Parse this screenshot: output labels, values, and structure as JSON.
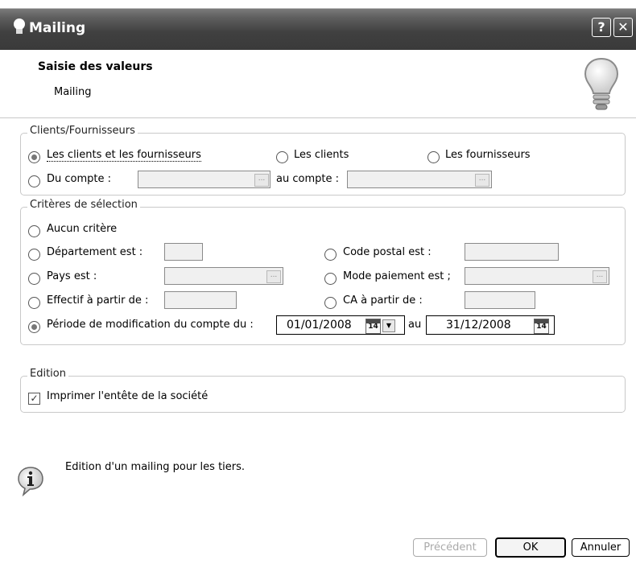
{
  "window": {
    "title": "Mailing",
    "help_label": "?",
    "close_label": "✕"
  },
  "header": {
    "title": "Saisie des valeurs",
    "subtitle": "Mailing"
  },
  "group_tiers": {
    "legend": "Clients/Fournisseurs",
    "opt_all": "Les clients et les fournisseurs",
    "opt_clients": "Les clients",
    "opt_fournisseurs": "Les fournisseurs",
    "opt_du_compte": "Du compte :",
    "au_compte": "au compte :",
    "selected": "opt_all"
  },
  "group_criteres": {
    "legend": "Critères de sélection",
    "aucun": "Aucun critère",
    "departement": "Département est :",
    "code_postal": "Code postal est :",
    "pays": "Pays est :",
    "mode_paiement": "Mode paiement est ;",
    "effectif": "Effectif à partir de :",
    "ca": "CA à partir de :",
    "periode": "Période de modification du compte du :",
    "date_from": "01/01/2008",
    "date_to_label": "au",
    "date_to": "31/12/2008",
    "calendar_day": "14",
    "selected": "periode"
  },
  "group_edition": {
    "legend": "Edition",
    "print_header": "Imprimer l'entête de la société",
    "print_header_checked": true
  },
  "info": {
    "text": "Edition d'un mailing pour les tiers."
  },
  "buttons": {
    "previous": "Précédent",
    "ok": "OK",
    "cancel": "Annuler"
  },
  "icons": {
    "title_icon": "lightbulb-icon",
    "header_icon": "lightbulb-icon",
    "info_icon": "info-icon"
  }
}
